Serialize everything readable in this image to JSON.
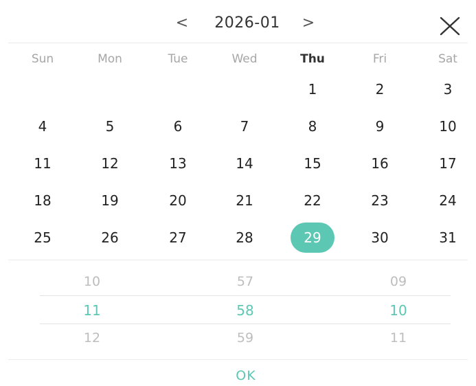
{
  "header": {
    "prev_label": "<",
    "next_label": ">",
    "month": "2026-01"
  },
  "weekdays": [
    "Sun",
    "Mon",
    "Tue",
    "Wed",
    "Thu",
    "Fri",
    "Sat"
  ],
  "current_weekday": "Thu",
  "days": [
    [
      "",
      "",
      "",
      "",
      "1",
      "2",
      "3"
    ],
    [
      "4",
      "5",
      "6",
      "7",
      "8",
      "9",
      "10"
    ],
    [
      "11",
      "12",
      "13",
      "14",
      "15",
      "16",
      "17"
    ],
    [
      "18",
      "19",
      "20",
      "21",
      "22",
      "23",
      "24"
    ],
    [
      "25",
      "26",
      "27",
      "28",
      "29",
      "30",
      "31"
    ]
  ],
  "selected_day": "29",
  "time": {
    "hour": {
      "prev": "10",
      "selected": "11",
      "next": "12"
    },
    "minute": {
      "prev": "57",
      "selected": "58",
      "next": "59"
    },
    "second": {
      "prev": "09",
      "selected": "10",
      "next": "11"
    }
  },
  "ok_label": "OK",
  "colors": {
    "accent": "#5cc8b4",
    "text": "#222222",
    "muted": "#a6a6a6",
    "wheel_muted": "#bdbdbd"
  }
}
